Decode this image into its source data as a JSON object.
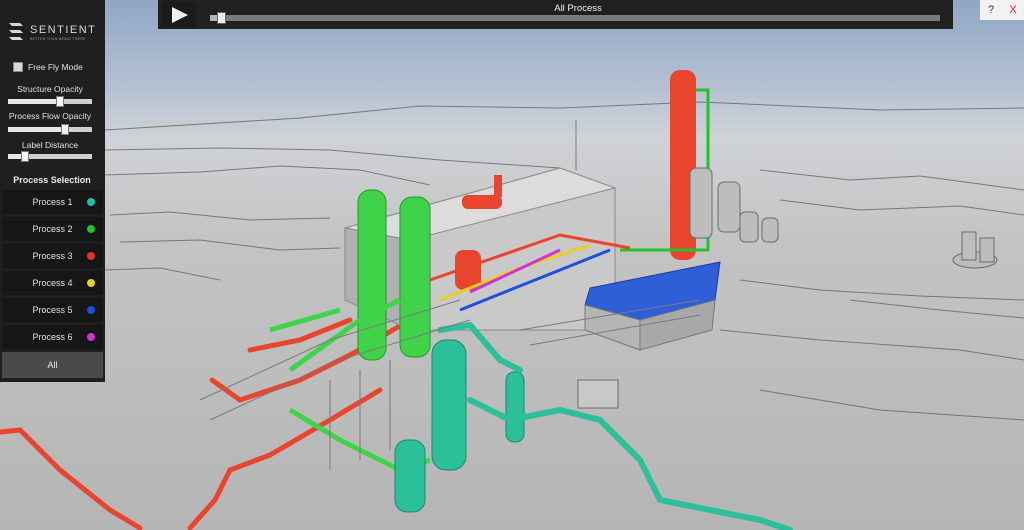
{
  "logo": {
    "name": "SENTIENT",
    "tagline": "BETTER THAN BEING THERE"
  },
  "controls": {
    "free_fly": {
      "label": "Free Fly Mode",
      "checked": false
    },
    "sliders": [
      {
        "label": "Structure Opacity",
        "value": 0.62
      },
      {
        "label": "Process Flow Opacity",
        "value": 0.68
      },
      {
        "label": "Label Distance",
        "value": 0.2
      }
    ]
  },
  "process_selection": {
    "title": "Process Selection",
    "items": [
      {
        "label": "Process 1",
        "color": "#1fbfa6"
      },
      {
        "label": "Process 2",
        "color": "#22c42a"
      },
      {
        "label": "Process 3",
        "color": "#e8321f"
      },
      {
        "label": "Process 4",
        "color": "#e6d21a"
      },
      {
        "label": "Process 5",
        "color": "#1f4fe0"
      },
      {
        "label": "Process 6",
        "color": "#d42fd8"
      }
    ],
    "all_label": "All"
  },
  "playback": {
    "title": "All Process",
    "progress": 0.01
  },
  "corner": {
    "help": "?",
    "close": "X"
  },
  "icons": {
    "play": "play-triangle-icon",
    "logo": "sentient-logo-icon"
  }
}
